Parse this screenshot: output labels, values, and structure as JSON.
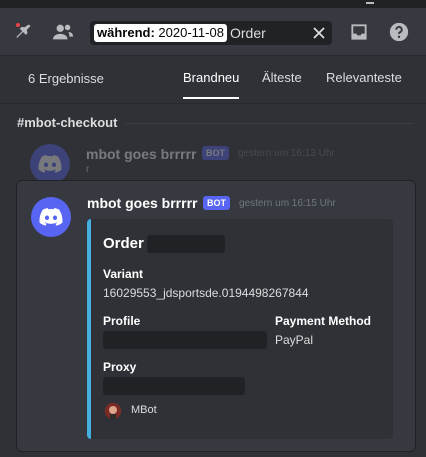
{
  "toolbar": {
    "pin_icon": "pin-icon",
    "members_icon": "members-icon",
    "inbox_icon": "inbox-icon",
    "help_icon": "help-icon",
    "search": {
      "filter_key": "während:",
      "filter_value": "2020-11-08",
      "query": "Order",
      "clear_icon": "close-icon"
    }
  },
  "results": {
    "count_label": "6 Ergebnisse",
    "tabs": [
      {
        "label": "Brandneu",
        "active": true
      },
      {
        "label": "Älteste",
        "active": false
      },
      {
        "label": "Relevanteste",
        "active": false
      }
    ],
    "channel": "#mbot-checkout",
    "context_message": {
      "author": "mbot goes brrrrr",
      "badge": "BOT",
      "timestamp": "gestern um 16:13 Uhr",
      "snippet": "r"
    },
    "result_message": {
      "author": "mbot goes brrrrr",
      "badge": "BOT",
      "timestamp": "gestern um 16:15 Uhr",
      "embed": {
        "accent_color": "#43b0e0",
        "title": "Order",
        "fields": [
          {
            "name": "Variant",
            "value": "16029553_jdsportsde.0194498267844"
          },
          {
            "name": "Profile",
            "value": ""
          },
          {
            "name": "Payment Method",
            "value": "PayPal"
          },
          {
            "name": "Proxy",
            "value": ""
          }
        ],
        "footer": "MBot"
      }
    }
  },
  "colors": {
    "blurple": "#5865f2",
    "background": "#2f3136",
    "card": "#36393f"
  }
}
